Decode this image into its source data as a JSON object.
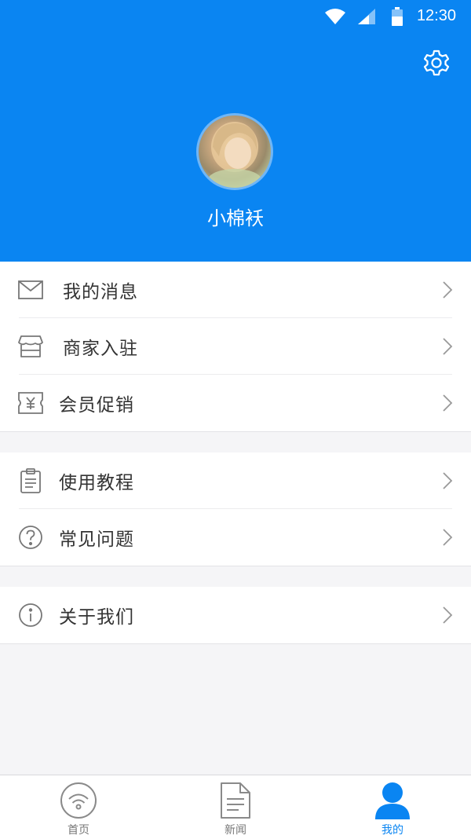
{
  "status_bar": {
    "time": "12:30"
  },
  "profile": {
    "username": "小棉袄"
  },
  "menu_groups": [
    [
      {
        "label": "我的消息",
        "icon": "mail-icon"
      },
      {
        "label": "商家入驻",
        "icon": "store-icon"
      },
      {
        "label": "会员促销",
        "icon": "coupon-icon"
      }
    ],
    [
      {
        "label": "使用教程",
        "icon": "clipboard-icon"
      },
      {
        "label": "常见问题",
        "icon": "question-icon"
      }
    ],
    [
      {
        "label": "关于我们",
        "icon": "info-icon"
      }
    ]
  ],
  "tab_bar": [
    {
      "label": "首页",
      "icon": "home-wifi-icon",
      "active": false
    },
    {
      "label": "新闻",
      "icon": "document-icon",
      "active": false
    },
    {
      "label": "我的",
      "icon": "user-icon",
      "active": true
    }
  ],
  "colors": {
    "brand": "#0a85f2",
    "background": "#f5f5f7"
  }
}
